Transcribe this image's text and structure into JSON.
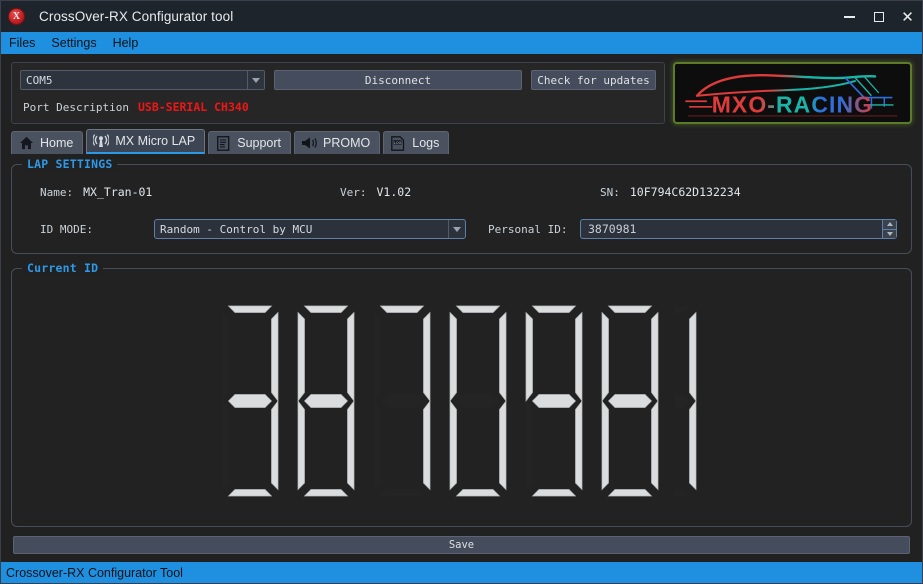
{
  "window": {
    "title": "CrossOver-RX Configurator tool",
    "app_icon": "app-logo-icon",
    "minimize": "–",
    "maximize": "□",
    "close": "✕"
  },
  "menubar": {
    "items": [
      {
        "label": "Files"
      },
      {
        "label": "Settings"
      },
      {
        "label": "Help"
      }
    ]
  },
  "connection": {
    "port_select_value": "COM5",
    "disconnect_label": "Disconnect",
    "check_updates_label": "Check for updates",
    "port_description_label": "Port Description",
    "port_description_value": "USB-SERIAL CH340"
  },
  "logo": {
    "text_parts": [
      "MX",
      "O",
      "-",
      "R",
      "A",
      "C",
      "I",
      "N",
      "G"
    ],
    "alt": "MXO-RACING",
    "colors": {
      "red": "#e03b3b",
      "teal": "#18b5a8",
      "blue": "#2d6fdc",
      "border_green": "#5d7a28"
    }
  },
  "tabs": [
    {
      "label": "Home",
      "icon": "home-icon",
      "active": false
    },
    {
      "label": "MX Micro LAP",
      "icon": "antenna-icon",
      "active": true
    },
    {
      "label": "Support",
      "icon": "document-icon",
      "active": false
    },
    {
      "label": "PROMO",
      "icon": "megaphone-icon",
      "active": false
    },
    {
      "label": "Logs",
      "icon": "log-file-icon",
      "active": false
    }
  ],
  "lap_settings": {
    "group_title": "LAP SETTINGS",
    "name_label": "Name:",
    "name_value": "MX_Tran-01",
    "ver_label": "Ver:",
    "ver_value": "V1.02",
    "sn_label": "SN:",
    "sn_value": "10F794C62D132234",
    "id_mode_label": "ID MODE:",
    "id_mode_value": "Random - Control by MCU",
    "personal_id_label": "Personal ID:",
    "personal_id_value": "3870981"
  },
  "current_id": {
    "group_title": "Current ID",
    "digits": "3870981",
    "segment_color": "#dadcdd"
  },
  "footer": {
    "save_label": "Save",
    "status_text": "Crossover-RX Configurator Tool"
  },
  "theme": {
    "accent_blue": "#1f8fe0",
    "group_label_blue": "#2c9ae8",
    "window_bg": "#212121",
    "panel_bg": "#262626",
    "alert_red": "#f01616"
  }
}
